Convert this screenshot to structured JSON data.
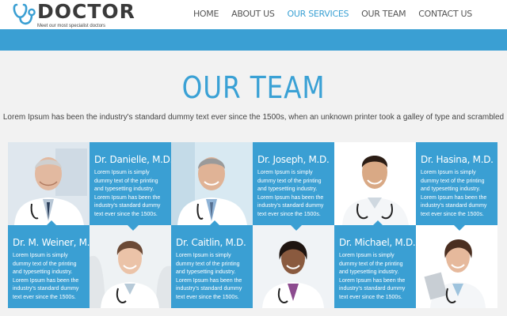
{
  "logo": {
    "text": "DOCTOR",
    "tagline": "Meet our most specialist doctors"
  },
  "nav": {
    "items": [
      {
        "label": "HOME",
        "active": false
      },
      {
        "label": "ABOUT US",
        "active": false
      },
      {
        "label": "OUR SERVICES",
        "active": true
      },
      {
        "label": "OUR TEAM",
        "active": false
      },
      {
        "label": "CONTACT US",
        "active": false
      }
    ]
  },
  "team": {
    "title": "OUR TEAM",
    "subtitle": "Lorem Ipsum has been the industry's standard dummy text ever since the 1500s, when an unknown printer took a galley of type and scrambled",
    "members": [
      {
        "name": "Dr. Danielle, M.D.",
        "desc": "Lorem Ipsum is simply dummy text of the printing and typesetting industry. Lorem Ipsum has been the industry's standard dummy text ever since the 1500s."
      },
      {
        "name": "Dr. Joseph, M.D.",
        "desc": "Lorem Ipsum is simply dummy text of the printing and typesetting industry. Lorem Ipsum has been the industry's standard dummy text ever since the 1500s."
      },
      {
        "name": "Dr. Hasina, M.D.",
        "desc": "Lorem Ipsum is simply dummy text of the printing and typesetting industry. Lorem Ipsum has been the industry's standard dummy text ever since the 1500s."
      },
      {
        "name": "Dr. M. Weiner, M.D.",
        "desc": "Lorem Ipsum is simply dummy text of the printing and typesetting industry. Lorem Ipsum has been the industry's standard dummy text ever since the 1500s."
      },
      {
        "name": "Dr. Caitlin, M.D.",
        "desc": "Lorem Ipsum is simply dummy text of the printing and typesetting industry. Lorem Ipsum has been the industry's standard dummy text ever since the 1500s."
      },
      {
        "name": "Dr. Michael, M.D.",
        "desc": "Lorem Ipsum is simply dummy text of the printing and typesetting industry. Lorem Ipsum has been the industry's standard dummy text ever since the 1500s."
      }
    ]
  },
  "colors": {
    "accent": "#3a9fd3",
    "title": "#3aa1d5",
    "nav_active": "#39a0d3",
    "background": "#f2f2f2"
  }
}
